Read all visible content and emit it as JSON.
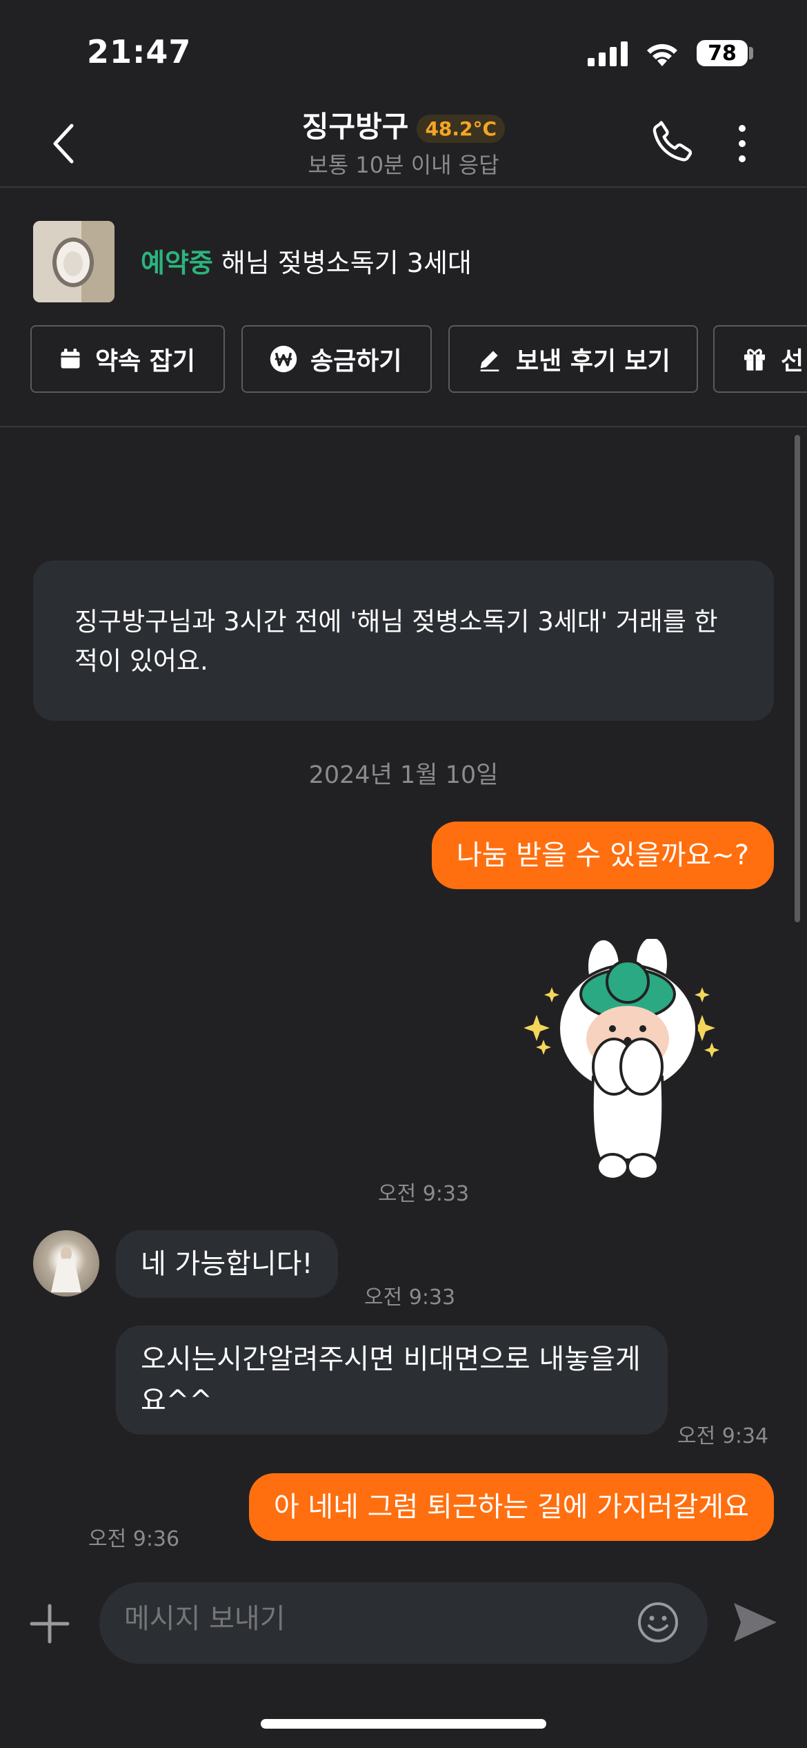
{
  "status_bar": {
    "time": "21:47",
    "battery": "78"
  },
  "header": {
    "title": "징구방구",
    "temperature": "48.2°C",
    "subtitle": "보통 10분 이내 응답"
  },
  "product": {
    "status": "예약중",
    "name": "해님 젖병소독기 3세대"
  },
  "actions": [
    {
      "label": "약속 잡기",
      "icon": "calendar-icon"
    },
    {
      "label": "송금하기",
      "icon": "won-icon"
    },
    {
      "label": "보낸 후기 보기",
      "icon": "pencil-icon"
    },
    {
      "label": "선",
      "icon": "gift-icon"
    }
  ],
  "notice": "징구방구님과 3시간 전에 '해님 젖병소독기 3세대' 거래를 한 적이 있어요.",
  "date_separator": "2024년 1월 10일",
  "messages": [
    {
      "from": "me",
      "text": "나눔 받을 수 있을까요~?"
    },
    {
      "from": "me",
      "sticker": "bunny-sticker",
      "time": "오전 9:33"
    },
    {
      "from": "other",
      "text": "네 가능합니다!",
      "time": "오전 9:33"
    },
    {
      "from": "other",
      "text": "오시는시간알려주시면 비대면으로 내놓을게요^^",
      "time": "오전 9:34"
    },
    {
      "from": "me",
      "text": "아 네네 그럼 퇴근하는 길에 가지러갈게요",
      "time": "오전 9:36"
    }
  ],
  "composer": {
    "placeholder": "메시지 보내기"
  },
  "colors": {
    "accent": "#ff6f0f",
    "reserved": "#2cb47d",
    "temperature": "#f5a524",
    "background": "#212124"
  }
}
